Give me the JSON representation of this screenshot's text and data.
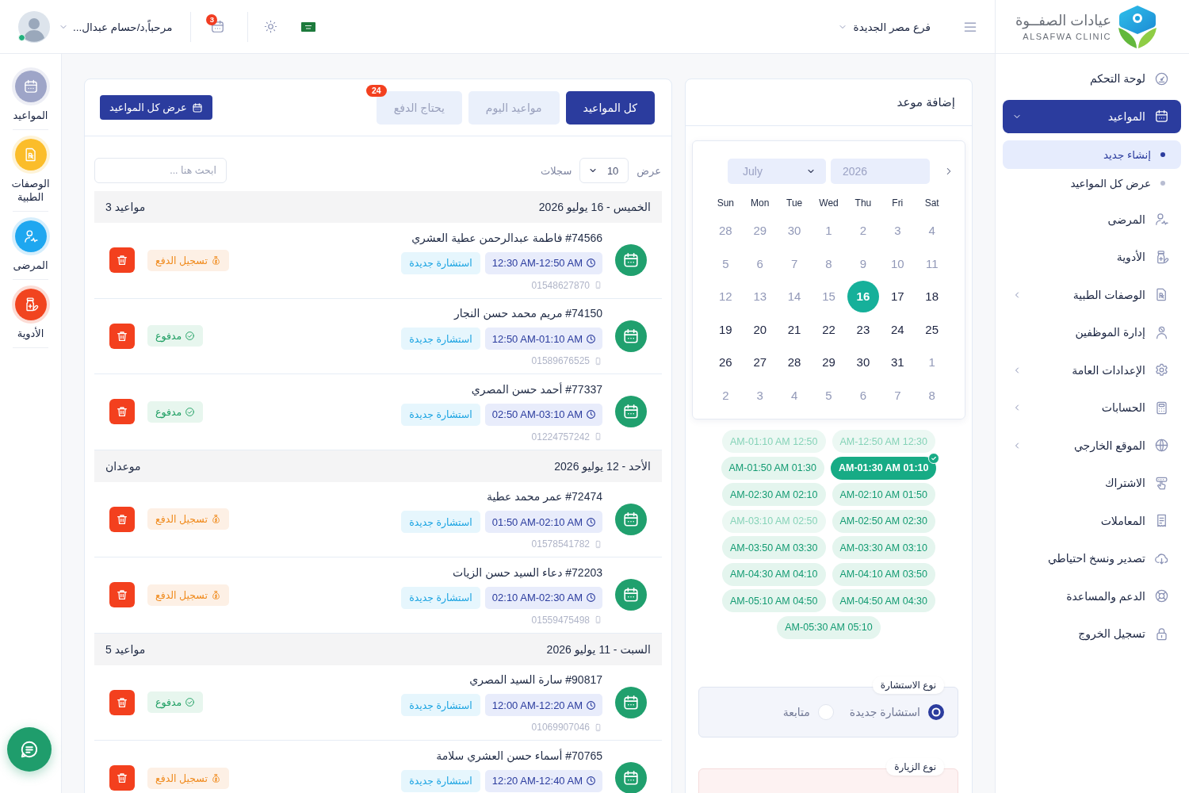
{
  "sidebar": {
    "logo": {
      "name": "عيادات الصفــوة",
      "tagline": "ALSAFWA CLINIC"
    },
    "items": [
      {
        "label": "لوحة التحكم",
        "selected": false
      },
      {
        "label": "المواعيد",
        "selected": true,
        "expanded": true,
        "children": [
          {
            "label": "إنشاء جديد",
            "selected": true
          },
          {
            "label": "عرض كل المواعيد",
            "selected": false
          }
        ]
      },
      {
        "label": "المرضى",
        "selected": false
      },
      {
        "label": "الأدوية",
        "selected": false
      },
      {
        "label": "الوصفات الطبية",
        "selected": false,
        "expanded": false
      },
      {
        "label": "إدارة الموظفين",
        "selected": false
      },
      {
        "label": "الإعدادات العامة",
        "selected": false,
        "expanded": false
      },
      {
        "label": "الحسابات",
        "selected": false,
        "expanded": false
      },
      {
        "label": "الموقع الخارجي",
        "selected": false,
        "expanded": false
      },
      {
        "label": "الاشتراك",
        "selected": false
      },
      {
        "label": "المعاملات",
        "selected": false
      },
      {
        "label": "تصدير ونسخ احتياطي",
        "selected": false
      },
      {
        "label": "الدعم والمساعدة",
        "selected": false
      },
      {
        "label": "تسجيل الخروج",
        "selected": false
      }
    ]
  },
  "header": {
    "branch": "فرع مصر الجديدة",
    "notifications": "3",
    "user": {
      "greeting": "مرحباً,د/حسام عبدال...",
      "online": true
    }
  },
  "booking": {
    "title": "إضافة موعد",
    "calendar": {
      "month": "July",
      "year": "2026",
      "weekdays": [
        "Sat",
        "Fri",
        "Thu",
        "Wed",
        "Tue",
        "Mon",
        "Sun"
      ],
      "days": [
        {
          "label": "4",
          "muted": true,
          "selected": false
        },
        {
          "label": "3",
          "muted": true,
          "selected": false
        },
        {
          "label": "2",
          "muted": true,
          "selected": false
        },
        {
          "label": "1",
          "muted": true,
          "selected": false
        },
        {
          "label": "30",
          "muted": true,
          "selected": false
        },
        {
          "label": "29",
          "muted": true,
          "selected": false
        },
        {
          "label": "28",
          "muted": true,
          "selected": false
        },
        {
          "label": "11",
          "muted": true,
          "selected": false
        },
        {
          "label": "10",
          "muted": true,
          "selected": false
        },
        {
          "label": "9",
          "muted": true,
          "selected": false
        },
        {
          "label": "8",
          "muted": true,
          "selected": false
        },
        {
          "label": "7",
          "muted": true,
          "selected": false
        },
        {
          "label": "6",
          "muted": true,
          "selected": false
        },
        {
          "label": "5",
          "muted": true,
          "selected": false
        },
        {
          "label": "18",
          "muted": false,
          "selected": false
        },
        {
          "label": "17",
          "muted": false,
          "selected": false
        },
        {
          "label": "16",
          "muted": false,
          "selected": true
        },
        {
          "label": "15",
          "muted": true,
          "selected": false
        },
        {
          "label": "14",
          "muted": true,
          "selected": false
        },
        {
          "label": "13",
          "muted": true,
          "selected": false
        },
        {
          "label": "12",
          "muted": true,
          "selected": false
        },
        {
          "label": "25",
          "muted": false,
          "selected": false
        },
        {
          "label": "24",
          "muted": false,
          "selected": false
        },
        {
          "label": "23",
          "muted": false,
          "selected": false
        },
        {
          "label": "22",
          "muted": false,
          "selected": false
        },
        {
          "label": "21",
          "muted": false,
          "selected": false
        },
        {
          "label": "20",
          "muted": false,
          "selected": false
        },
        {
          "label": "19",
          "muted": false,
          "selected": false
        },
        {
          "label": "1",
          "muted": true,
          "selected": false
        },
        {
          "label": "31",
          "muted": false,
          "selected": false
        },
        {
          "label": "30",
          "muted": false,
          "selected": false
        },
        {
          "label": "29",
          "muted": false,
          "selected": false
        },
        {
          "label": "28",
          "muted": false,
          "selected": false
        },
        {
          "label": "27",
          "muted": false,
          "selected": false
        },
        {
          "label": "26",
          "muted": false,
          "selected": false
        },
        {
          "label": "8",
          "muted": true,
          "selected": false
        },
        {
          "label": "7",
          "muted": true,
          "selected": false
        },
        {
          "label": "6",
          "muted": true,
          "selected": false
        },
        {
          "label": "5",
          "muted": true,
          "selected": false
        },
        {
          "label": "4",
          "muted": true,
          "selected": false
        },
        {
          "label": "3",
          "muted": true,
          "selected": false
        },
        {
          "label": "2",
          "muted": true,
          "selected": false
        }
      ]
    },
    "slots": [
      {
        "label": "AM-12:50 AM 12:30",
        "disabled": true,
        "selected": false
      },
      {
        "label": "AM-01:10 AM 12:50",
        "disabled": true,
        "selected": false
      },
      {
        "label": "AM-01:30 AM 01:10",
        "disabled": false,
        "selected": true
      },
      {
        "label": "AM-01:50 AM 01:30",
        "disabled": false,
        "selected": false
      },
      {
        "label": "AM-02:10 AM 01:50",
        "disabled": false,
        "selected": false
      },
      {
        "label": "AM-02:30 AM 02:10",
        "disabled": false,
        "selected": false
      },
      {
        "label": "AM-02:50 AM 02:30",
        "disabled": false,
        "selected": false
      },
      {
        "label": "AM-03:10 AM 02:50",
        "disabled": true,
        "selected": false
      },
      {
        "label": "AM-03:30 AM 03:10",
        "disabled": false,
        "selected": false
      },
      {
        "label": "AM-03:50 AM 03:30",
        "disabled": false,
        "selected": false
      },
      {
        "label": "AM-04:10 AM 03:50",
        "disabled": false,
        "selected": false
      },
      {
        "label": "AM-04:30 AM 04:10",
        "disabled": false,
        "selected": false
      },
      {
        "label": "AM-04:50 AM 04:30",
        "disabled": false,
        "selected": false
      },
      {
        "label": "AM-05:10 AM 04:50",
        "disabled": false,
        "selected": false
      },
      {
        "label": "AM-05:30 AM 05:10",
        "disabled": false,
        "selected": false
      }
    ],
    "consultation_type": {
      "legend": "نوع الاستشارة",
      "options": [
        {
          "label": "استشارة جديدة",
          "selected": true
        },
        {
          "label": "متابعة",
          "selected": false
        }
      ]
    },
    "visit_type": {
      "legend": "نوع الزيارة"
    }
  },
  "appointments": {
    "tabs": [
      {
        "label": "كل المواعيد",
        "selected": true
      },
      {
        "label": "مواعيد اليوم",
        "selected": false
      },
      {
        "label": "يحتاج الدفع",
        "selected": false,
        "badge": "24"
      }
    ],
    "view_all": "عرض كل المواعيد",
    "page_size": {
      "prefix": "عرض",
      "value": "10",
      "suffix": "سجلات"
    },
    "search": {
      "placeholder": "ابحث هنا ..."
    },
    "groups": [
      {
        "date": "الخميس - 16 يوليو 2026",
        "count": "3 مواعيد",
        "appointments": [
          {
            "title": "#74566 فاطمة عبدالرحمن عطية العشري",
            "time": "12:30 AM-12:50 AM",
            "type": "استشارة جديدة",
            "phone": "01548627870",
            "payment": {
              "kind": "unpaid",
              "label": "تسجيل الدفع"
            }
          },
          {
            "title": "#74150 مريم محمد حسن النجار",
            "time": "12:50 AM-01:10 AM",
            "type": "استشارة جديدة",
            "phone": "01589676525",
            "payment": {
              "kind": "paid",
              "label": "مدفوع"
            }
          },
          {
            "title": "#77337 أحمد حسن المصري",
            "time": "02:50 AM-03:10 AM",
            "type": "استشارة جديدة",
            "phone": "01224757242",
            "payment": {
              "kind": "paid",
              "label": "مدفوع"
            }
          }
        ]
      },
      {
        "date": "الأحد - 12 يوليو 2026",
        "count": "موعدان",
        "appointments": [
          {
            "title": "#72474 عمر محمد عطية",
            "time": "01:50 AM-02:10 AM",
            "type": "استشارة جديدة",
            "phone": "01578541782",
            "payment": {
              "kind": "unpaid",
              "label": "تسجيل الدفع"
            }
          },
          {
            "title": "#72203 دعاء السيد حسن الزيات",
            "time": "02:10 AM-02:30 AM",
            "type": "استشارة جديدة",
            "phone": "01559475498",
            "payment": {
              "kind": "unpaid",
              "label": "تسجيل الدفع"
            }
          }
        ]
      },
      {
        "date": "السبت - 11 يوليو 2026",
        "count": "5 مواعيد",
        "appointments": [
          {
            "title": "#90817 سارة السيد المصري",
            "time": "12:00 AM-12:20 AM",
            "type": "استشارة جديدة",
            "phone": "01069907046",
            "payment": {
              "kind": "paid",
              "label": "مدفوع"
            }
          },
          {
            "title": "#70765 أسماء حسن العشري سلامة",
            "time": "12:20 AM-12:40 AM",
            "type": "استشارة جديدة",
            "payment": {
              "kind": "unpaid",
              "label": "تسجيل الدفع"
            }
          }
        ]
      }
    ]
  },
  "quick_links": [
    {
      "label": "المواعيد",
      "color": "#9ea5c8"
    },
    {
      "label": "الوصفات الطبية",
      "color": "#fbbd2a"
    },
    {
      "label": "المرضى",
      "color": "#1ea7f0"
    },
    {
      "label": "الأدوية",
      "color": "#f1441f"
    }
  ]
}
